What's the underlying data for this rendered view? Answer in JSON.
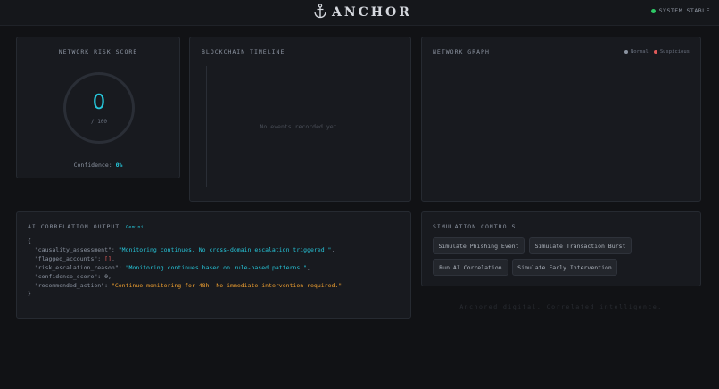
{
  "header": {
    "brand_name": "ANCHOR",
    "logo_icon": "anchor-icon",
    "status_text": "SYSTEM STABLE",
    "status_color": "#2ec866"
  },
  "risk": {
    "title": "NETWORK RISK SCORE",
    "score": "0",
    "max": "/ 100",
    "confidence_label": "Confidence:",
    "confidence_value": "0%",
    "accent": "#26c6da"
  },
  "timeline": {
    "title": "BLOCKCHAIN TIMELINE",
    "empty_text": "No events recorded yet."
  },
  "graph": {
    "title": "NETWORK GRAPH",
    "legend": [
      {
        "label": "Normal",
        "color": "#8b93a0"
      },
      {
        "label": "Suspicious",
        "color": "#e05a5a"
      }
    ]
  },
  "ai": {
    "title": "AI CORRELATION OUTPUT",
    "tag": "Gemini",
    "open_brace": "{",
    "close_brace": "}",
    "rows": {
      "causality_key": "\"causality_assessment\"",
      "causality_value": "\"Monitoring continues. No cross-domain escalation triggered.\"",
      "flagged_key": "\"flagged_accounts\"",
      "flagged_value": "[]",
      "risk_key": "\"risk_escalation_reason\"",
      "risk_value": "\"Monitoring continues based on rule-based patterns.\"",
      "confidence_key": "\"confidence_score\"",
      "confidence_value": "0",
      "action_key": "\"recommended_action\"",
      "action_value": "\"Continue monitoring for 48h. No immediate intervention required.\""
    }
  },
  "simulation": {
    "title": "SIMULATION CONTROLS",
    "buttons": [
      "Simulate Phishing Event",
      "Simulate Transaction Burst",
      "Run AI Correlation",
      "Simulate Early Intervention"
    ]
  },
  "footer": {
    "text": "Anchored digital. Correlated intelligence."
  }
}
